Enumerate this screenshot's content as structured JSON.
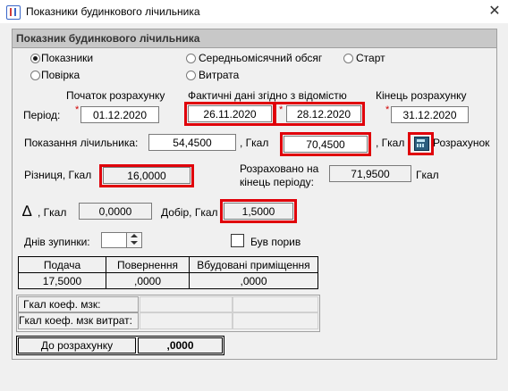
{
  "window": {
    "title": "Показники будинкового лічильника",
    "close_glyph": "✕"
  },
  "panel": {
    "header": "Показник будинкового лічильника"
  },
  "radios": [
    {
      "label": "Показники",
      "checked": true
    },
    {
      "label": "Повірка",
      "checked": false
    },
    {
      "label": "Середньомісячний обсяг",
      "checked": false
    },
    {
      "label": "Витрата",
      "checked": false
    },
    {
      "label": "Старт",
      "checked": false
    }
  ],
  "period": {
    "label": "Період:",
    "start_header": "Початок розрахунку",
    "actual_header": "Фактичні дані згідно з відомістю",
    "end_header": "Кінець розрахунку",
    "start_date": "01.12.2020",
    "actual_from": "26.11.2020",
    "actual_to": "28.12.2020",
    "end_date": "31.12.2020",
    "required_mark": "*"
  },
  "readings": {
    "label": "Показання лічильника:",
    "prev_value": "54,4500",
    "unit1": ", Гкал",
    "curr_value": "70,4500",
    "unit2": ", Гкал",
    "calc_label": "Розрахунок"
  },
  "difference": {
    "label": "Різниця, Гкал",
    "value": "16,0000"
  },
  "calculated": {
    "label_line1": "Розраховано на",
    "label_line2": "кінець періоду:",
    "value": "71,9500",
    "unit": "Гкал"
  },
  "delta": {
    "symbol": "∆",
    "label": ", Гкал",
    "value": "0,0000"
  },
  "dobir": {
    "label": "Добір, Гкал",
    "value": "1,5000"
  },
  "stop_days": {
    "label": "Днів зупинки:",
    "value": ""
  },
  "rupture": {
    "label": "Був порив",
    "checked": false
  },
  "supply_table": {
    "headers": [
      "Подача",
      "Повернення",
      "Вбудовані приміщення"
    ],
    "values": [
      "17,5000",
      ",0000",
      ",0000"
    ]
  },
  "coef_table": {
    "rows": [
      "Гкал коеф. мзк:",
      "Гкал коеф. мзк витрат:"
    ]
  },
  "total": {
    "label": "До розрахунку",
    "value": ",0000"
  },
  "colors": {
    "highlight": "#e0000a",
    "required": "#d00000"
  }
}
